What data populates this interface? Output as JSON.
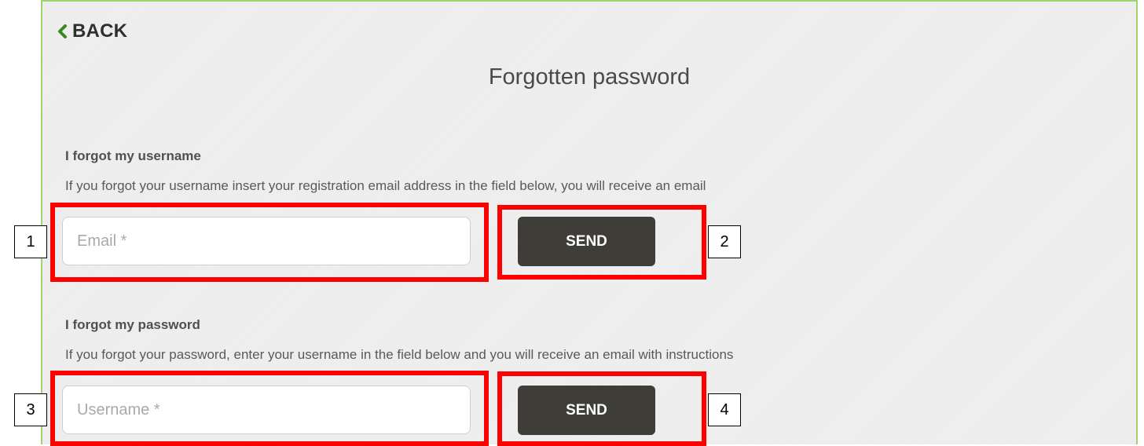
{
  "back": {
    "label": "BACK",
    "icon": "chevron-left-icon",
    "color": "#3a8a1f"
  },
  "title": "Forgotten password",
  "username_section": {
    "heading": "I forgot my username",
    "description": "If you forgot your username insert your registration email address in the field below, you will receive an email",
    "input_placeholder": "Email *",
    "input_value": "",
    "button_label": "SEND"
  },
  "password_section": {
    "heading": "I forgot my password",
    "description": "If you forgot your password, enter your username in the field below and you will receive an email with instructions",
    "input_placeholder": "Username *",
    "input_value": "",
    "button_label": "SEND"
  },
  "annotations": [
    {
      "label": "1"
    },
    {
      "label": "2"
    },
    {
      "label": "3"
    },
    {
      "label": "4"
    }
  ],
  "colors": {
    "panel_background": "#efefef",
    "panel_border": "#9fd36b",
    "button_background": "#3f3d38",
    "highlight": "#ff0000"
  }
}
